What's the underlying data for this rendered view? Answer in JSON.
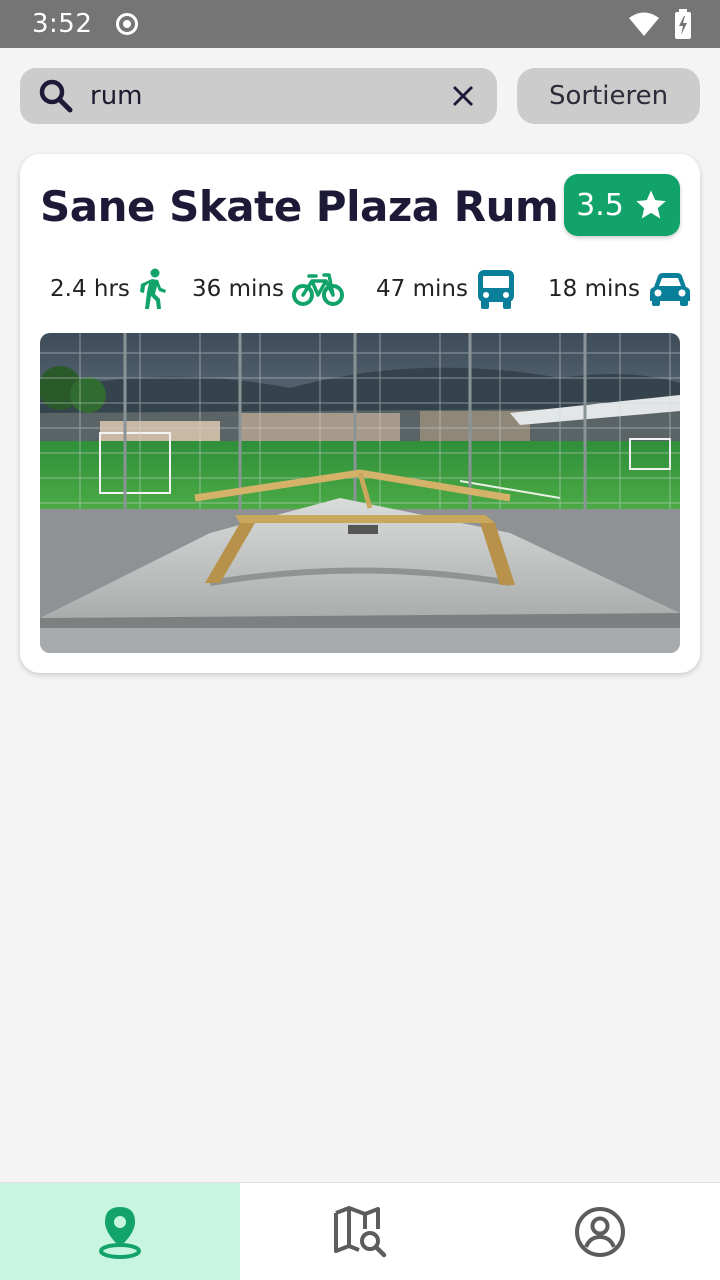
{
  "status_bar": {
    "time": "3:52"
  },
  "search": {
    "value": "rum"
  },
  "sort_button": {
    "label": "Sortieren"
  },
  "results": [
    {
      "name": "Sane Skate Plaza Rum",
      "rating": "3.5",
      "travel": {
        "walk": "2.4 hrs",
        "bike": "36 mins",
        "bus": "47 mins",
        "car": "18 mins"
      }
    }
  ],
  "colors": {
    "accent_green": "#12a36a",
    "transit_teal": "#0a7f9a",
    "nav_active_bg": "#c8f5e1"
  },
  "icons": {
    "walk": "walk-icon",
    "bike": "bike-icon",
    "bus": "bus-icon",
    "car": "car-icon",
    "rating": "star-icon"
  },
  "bottom_nav": {
    "items": [
      {
        "icon": "location-pin-icon",
        "active": true
      },
      {
        "icon": "map-search-icon",
        "active": false
      },
      {
        "icon": "profile-icon",
        "active": false
      }
    ]
  }
}
